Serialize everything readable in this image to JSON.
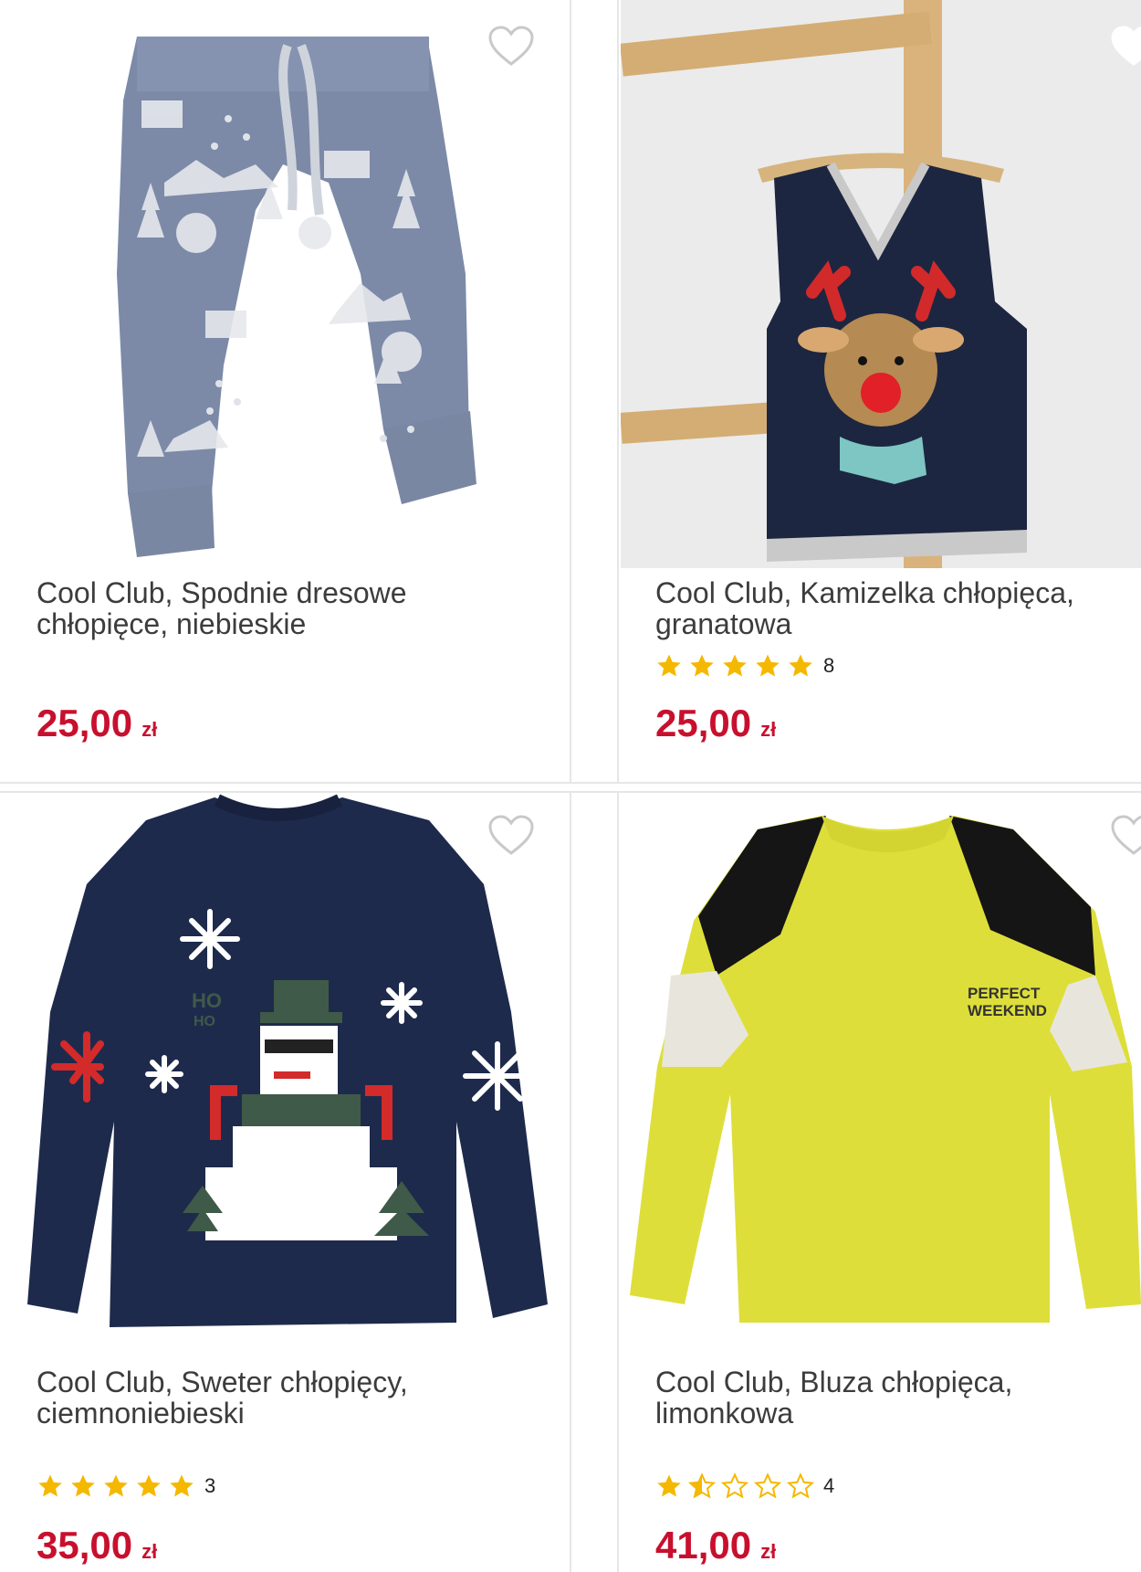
{
  "products": [
    {
      "title_line1": "Cool Club, Spodnie dresowe",
      "title_line2": "chłopięce, niebieskie",
      "rating": null,
      "review_count": "",
      "price": "25,00",
      "currency": "zł",
      "favorite": false,
      "image": "blue-jogger-pants-winter-print"
    },
    {
      "title_line1": "Cool Club, Kamizelka chłopięca,",
      "title_line2": "granatowa",
      "rating": 5,
      "review_count": "8",
      "price": "25,00",
      "currency": "zł",
      "favorite": true,
      "image": "navy-vest-reindeer"
    },
    {
      "title_line1": "Cool Club, Sweter chłopięcy,",
      "title_line2": "ciemnoniebieski",
      "rating": 5,
      "review_count": "3",
      "price": "35,00",
      "currency": "zł",
      "favorite": false,
      "image": "navy-sweater-snowman"
    },
    {
      "title_line1": "Cool Club, Bluza chłopięca,",
      "title_line2": "limonkowa",
      "rating": 1.5,
      "review_count": "4",
      "price": "41,00",
      "currency": "zł",
      "favorite": false,
      "image": "lime-sweatshirt-perfect-weekend",
      "print_text_line1": "PERFECT",
      "print_text_line2": "WEEKEND"
    }
  ],
  "colors": {
    "price": "#c8102e",
    "star": "#f5b800",
    "divider": "#e6e6e6",
    "text": "#3c3c3c"
  }
}
